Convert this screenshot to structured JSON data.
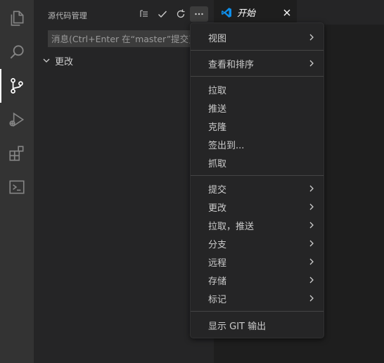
{
  "activity_bar": {
    "items": [
      {
        "icon": "explorer-icon"
      },
      {
        "icon": "search-icon"
      },
      {
        "icon": "source-control-icon",
        "active": true
      },
      {
        "icon": "run-debug-icon"
      },
      {
        "icon": "extensions-icon"
      },
      {
        "icon": "terminal-icon"
      }
    ]
  },
  "sidebar": {
    "title": "源代码管理",
    "actions": [
      "tree-view-icon",
      "check-icon",
      "refresh-icon",
      "more-icon"
    ],
    "commit_placeholder": "消息(Ctrl+Enter 在“master”提交)",
    "changes_label": "更改"
  },
  "editor": {
    "tab_label": "开始"
  },
  "menu": {
    "items": [
      {
        "label": "视图",
        "submenu": true
      },
      {
        "label": "查看和排序",
        "submenu": true
      },
      {
        "label": "拉取",
        "submenu": false
      },
      {
        "label": "推送",
        "submenu": false
      },
      {
        "label": "克隆",
        "submenu": false
      },
      {
        "label": "签出到...",
        "submenu": false
      },
      {
        "label": "抓取",
        "submenu": false
      },
      {
        "label": "提交",
        "submenu": true
      },
      {
        "label": "更改",
        "submenu": true
      },
      {
        "label": "拉取，推送",
        "submenu": true
      },
      {
        "label": "分支",
        "submenu": true
      },
      {
        "label": "远程",
        "submenu": true
      },
      {
        "label": "存储",
        "submenu": true
      },
      {
        "label": "标记",
        "submenu": true
      },
      {
        "label": "显示 GIT 输出",
        "submenu": false
      }
    ]
  },
  "colors": {
    "activity_bar": "#333333",
    "sidebar": "#252526",
    "editor": "#1e1e1e",
    "vscode_blue": "#0e8ee9"
  }
}
